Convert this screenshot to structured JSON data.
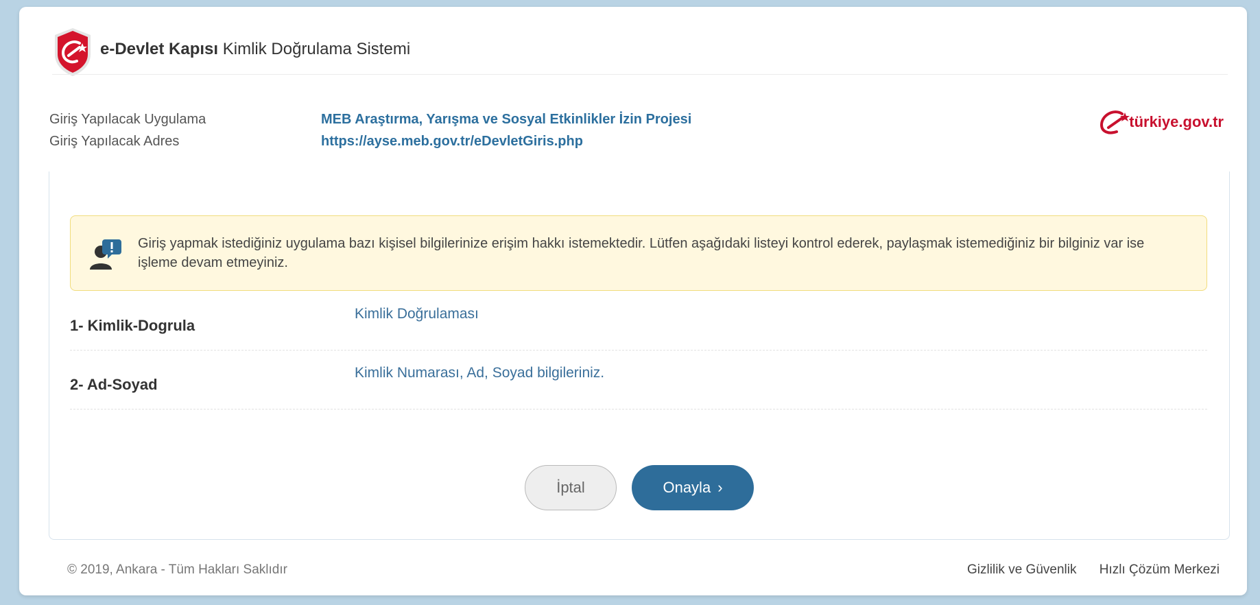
{
  "header": {
    "brand_bold": "e-Devlet Kapısı",
    "brand_rest": "Kimlik Doğrulama Sistemi"
  },
  "app_info": {
    "app_label": "Giriş Yapılacak Uygulama",
    "app_value": "MEB Araştırma, Yarışma ve Sosyal Etkinlikler İzin Projesi",
    "address_label": "Giriş Yapılacak Adres",
    "address_value": "https://ayse.meb.gov.tr/eDevletGiris.php"
  },
  "logo": {
    "text": "türkiye.gov.tr"
  },
  "notice": {
    "text": "Giriş yapmak istediğiniz uygulama bazı kişisel bilgilerinize erişim hakkı istemektedir. Lütfen aşağıdaki listeyi kontrol ederek, paylaşmak istemediğiniz bir bilginiz var ise işleme devam etmeyiniz."
  },
  "permissions": [
    {
      "name": "1- Kimlik-Dogrula",
      "desc": "Kimlik Doğrulaması"
    },
    {
      "name": "2- Ad-Soyad",
      "desc": "Kimlik Numarası, Ad, Soyad bilgileriniz."
    }
  ],
  "buttons": {
    "cancel": "İptal",
    "confirm": "Onayla"
  },
  "footer": {
    "copyright": "© 2019, Ankara - Tüm Hakları Saklıdır",
    "privacy": "Gizlilik ve Güvenlik",
    "help": "Hızlı Çözüm Merkezi"
  },
  "colors": {
    "brand_red": "#c8102e",
    "link_blue": "#2c6f9e",
    "button_blue": "#2e6d9a",
    "notice_bg": "#fff8df"
  }
}
